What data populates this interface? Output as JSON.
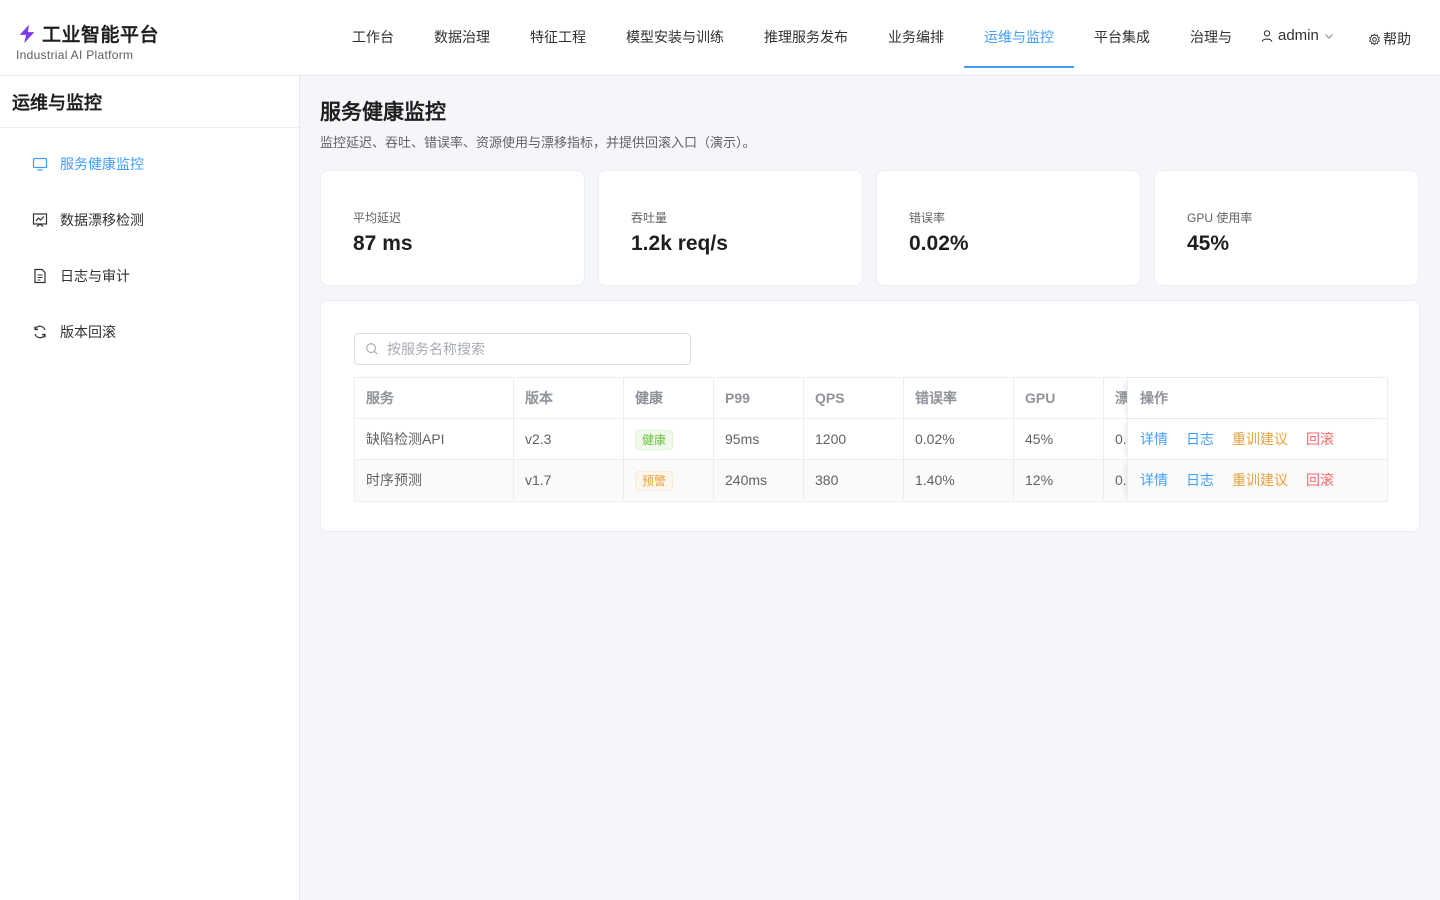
{
  "colors": {
    "accent": "#409eff",
    "warning": "#e6a23c",
    "danger": "#f56c6c",
    "success": "#67c23a",
    "brand": "#7c3aed"
  },
  "brand": {
    "title": "工业智能平台",
    "subtitle": "Industrial AI Platform",
    "logo_icon": "lightning-icon"
  },
  "nav": {
    "items": [
      {
        "label": "工作台"
      },
      {
        "label": "数据治理"
      },
      {
        "label": "特征工程"
      },
      {
        "label": "模型安装与训练"
      },
      {
        "label": "推理服务发布"
      },
      {
        "label": "业务编排"
      },
      {
        "label": "运维与监控",
        "active": true
      },
      {
        "label": "平台集成"
      },
      {
        "label": "治理与"
      }
    ],
    "user": "admin",
    "help": "帮助"
  },
  "sidebar": {
    "title": "运维与监控",
    "items": [
      {
        "label": "服务健康监控",
        "icon": "monitor-icon",
        "active": true
      },
      {
        "label": "数据漂移检测",
        "icon": "chart-icon"
      },
      {
        "label": "日志与审计",
        "icon": "document-icon"
      },
      {
        "label": "版本回滚",
        "icon": "refresh-icon"
      }
    ]
  },
  "main": {
    "title": "服务健康监控",
    "description": "监控延迟、吞吐、错误率、资源使用与漂移指标，并提供回滚入口（演示）。",
    "stats": [
      {
        "label": "平均延迟",
        "value": "87 ms"
      },
      {
        "label": "吞吐量",
        "value": "1.2k req/s"
      },
      {
        "label": "错误率",
        "value": "0.02%"
      },
      {
        "label": "GPU 使用率",
        "value": "45%"
      }
    ],
    "search_placeholder": "按服务名称搜索",
    "table": {
      "columns": [
        "服务",
        "版本",
        "健康",
        "P99",
        "QPS",
        "错误率",
        "GPU",
        "漂",
        "操作"
      ],
      "rows": [
        {
          "service": "缺陷检测API",
          "version": "v2.3",
          "health": "健康",
          "p99": "95ms",
          "qps": "1200",
          "error_rate": "0.02%",
          "gpu": "45%",
          "drift": "0."
        },
        {
          "service": "时序预测",
          "version": "v1.7",
          "health": "预警",
          "p99": "240ms",
          "qps": "380",
          "error_rate": "1.40%",
          "gpu": "12%",
          "drift": "0."
        }
      ],
      "actions": {
        "detail": "详情",
        "log": "日志",
        "retrain": "重训建议",
        "rollback": "回滚"
      }
    }
  }
}
